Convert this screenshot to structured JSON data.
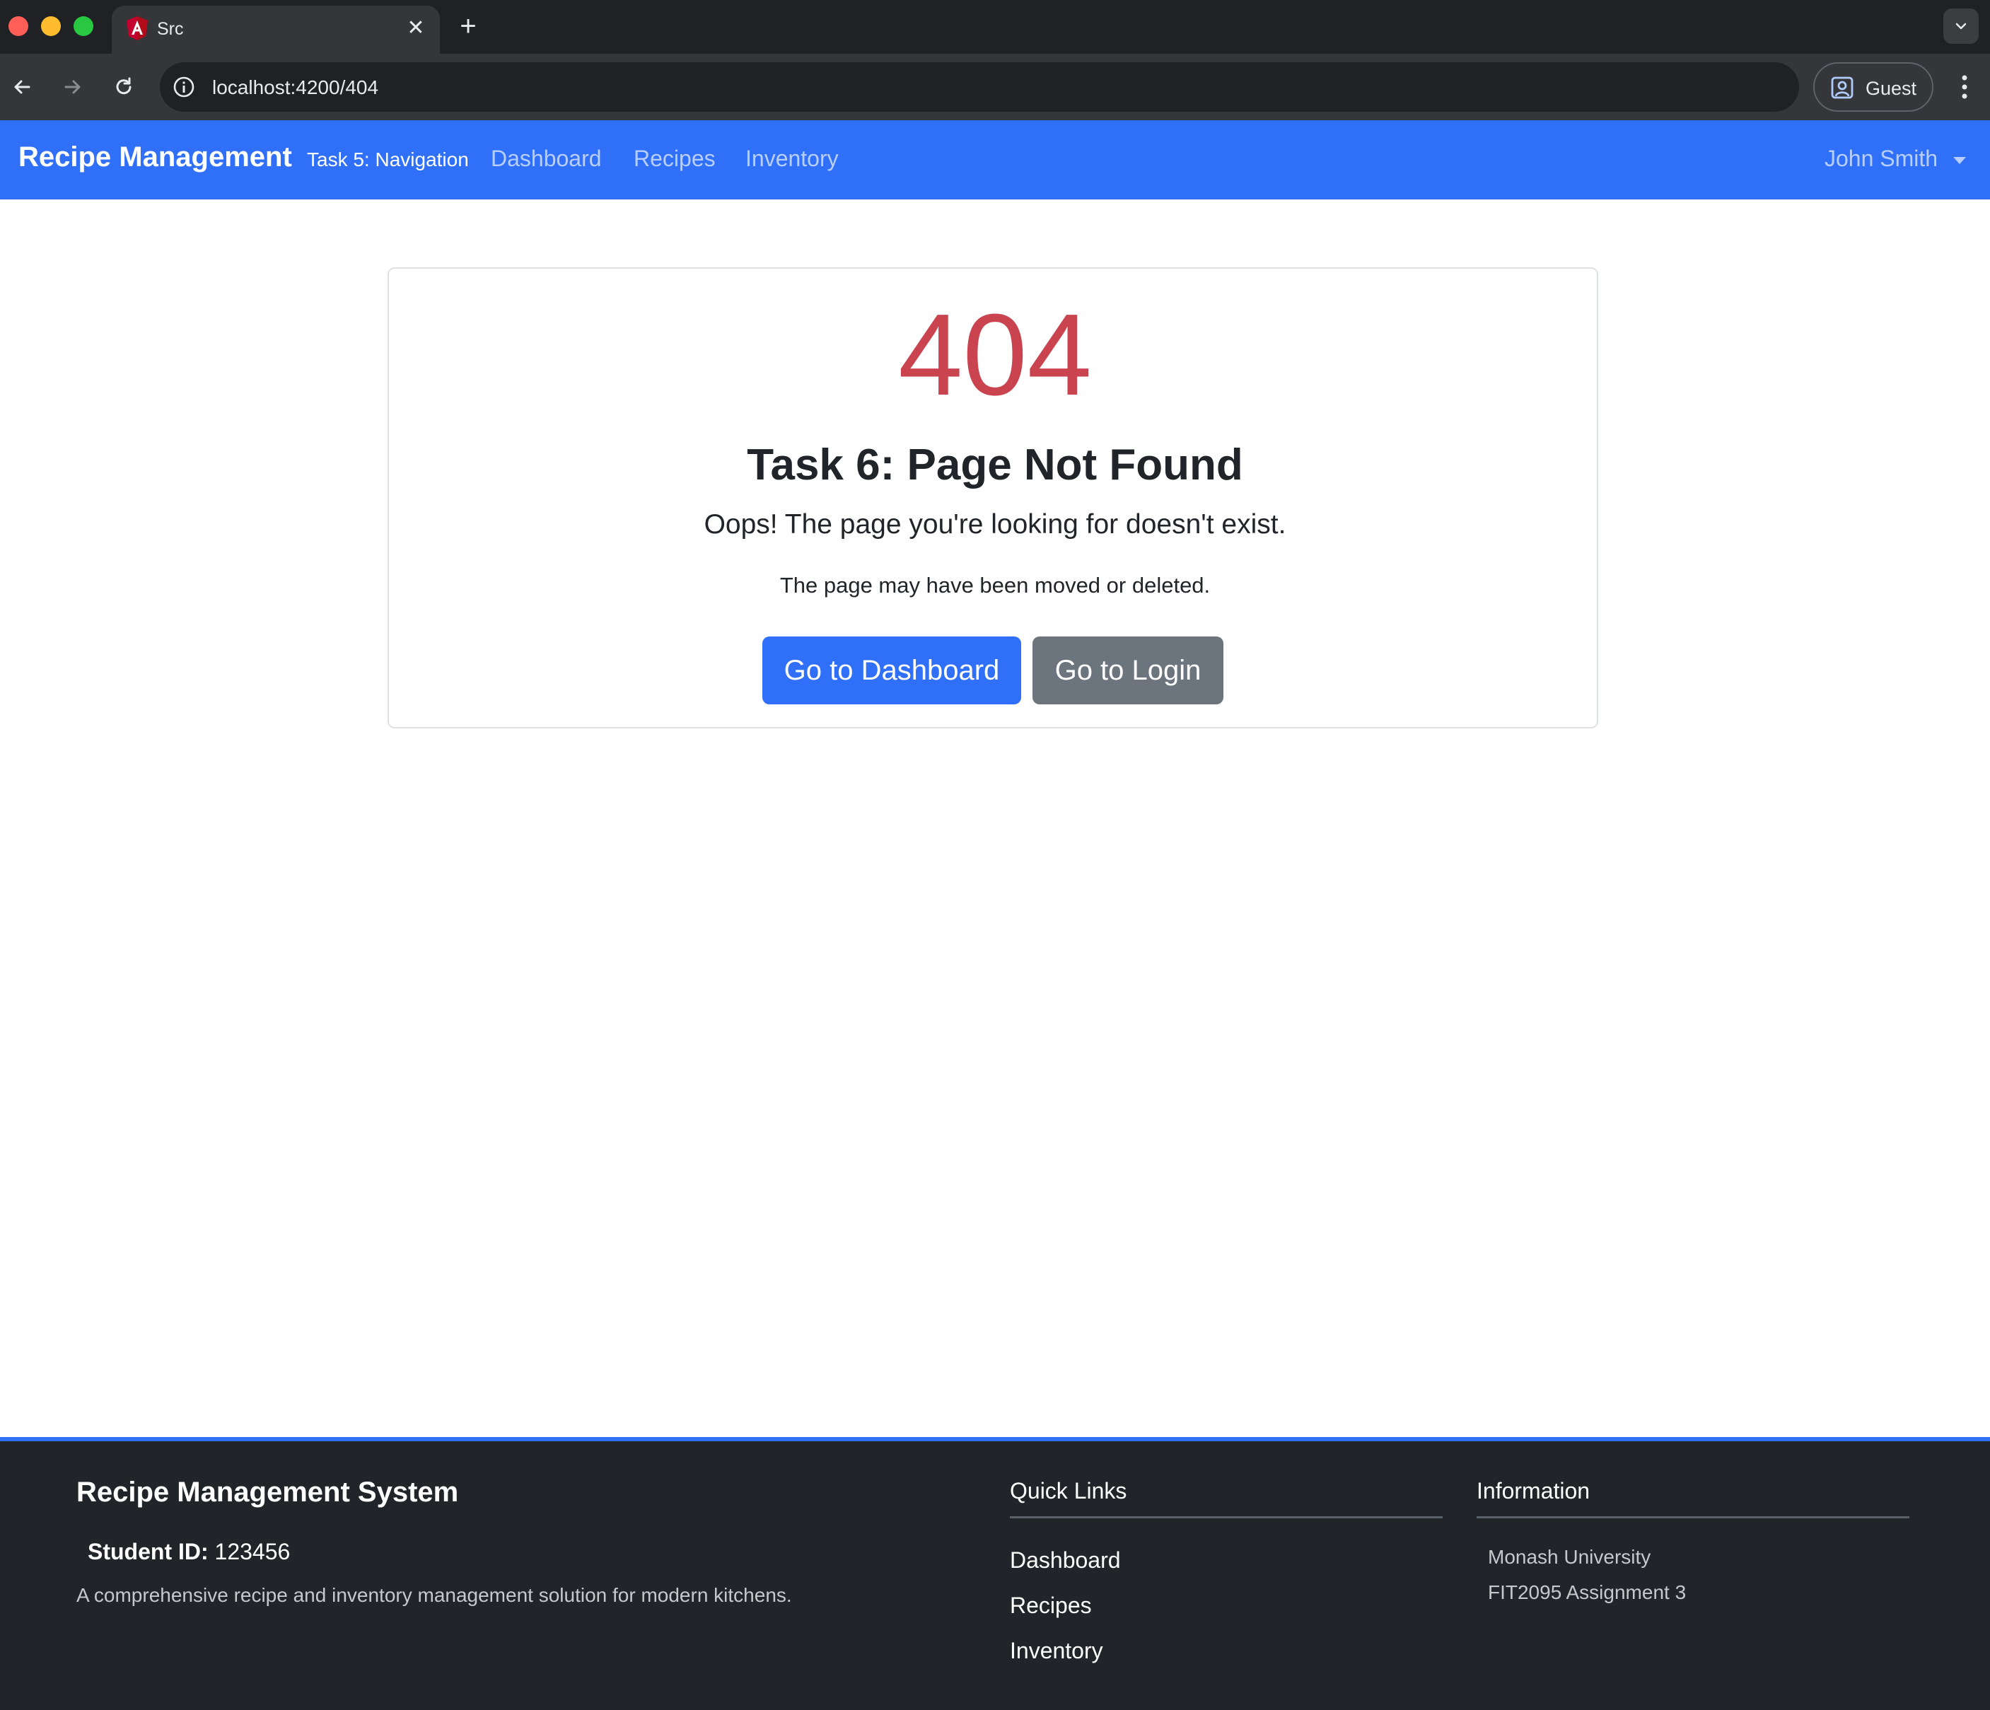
{
  "browser": {
    "tab_title": "Src",
    "url": "localhost:4200/404",
    "profile_label": "Guest"
  },
  "navbar": {
    "brand": "Recipe Management",
    "task_label": "Task 5: Navigation",
    "links": [
      "Dashboard",
      "Recipes",
      "Inventory"
    ],
    "user_name": "John Smith"
  },
  "error": {
    "code": "404",
    "title": "Task 6: Page Not Found",
    "lead": "Oops! The page you're looking for doesn't exist.",
    "sub": "The page may have been moved or deleted.",
    "primary_button": "Go to Dashboard",
    "secondary_button": "Go to Login"
  },
  "footer": {
    "title": "Recipe Management System",
    "student_label": "Student ID:",
    "student_id": "123456",
    "description": "A comprehensive recipe and inventory management solution for modern kitchens.",
    "quick_links_heading": "Quick Links",
    "quick_links": [
      "Dashboard",
      "Recipes",
      "Inventory"
    ],
    "info_heading": "Information",
    "info_lines": [
      "Monash University",
      "FIT2095 Assignment 3"
    ]
  },
  "colors": {
    "primary": "#306ff8",
    "danger": "#c9444e",
    "secondary": "#6c757d",
    "footer_bg": "#212529"
  }
}
